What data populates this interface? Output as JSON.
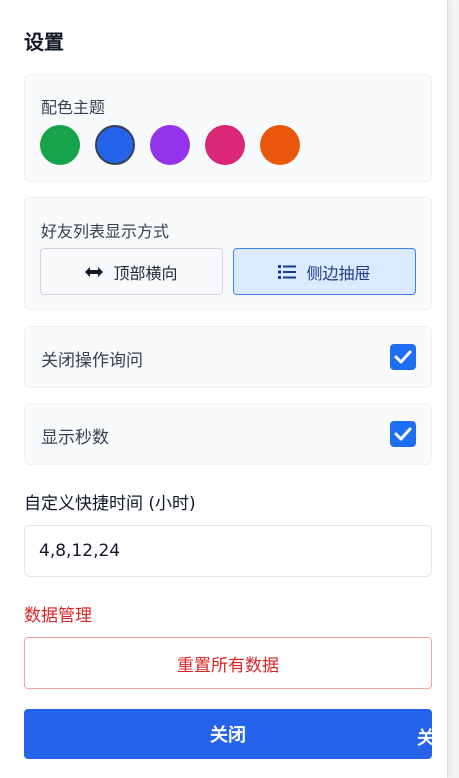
{
  "settings": {
    "title": "设置",
    "theme": {
      "label": "配色主题",
      "colors": [
        {
          "name": "green",
          "hex": "#16a34a"
        },
        {
          "name": "blue",
          "hex": "#2563eb",
          "selected": true
        },
        {
          "name": "purple",
          "hex": "#9333ea"
        },
        {
          "name": "pink",
          "hex": "#db2777"
        },
        {
          "name": "orange",
          "hex": "#ea580c"
        }
      ]
    },
    "friends_display": {
      "label": "好友列表显示方式",
      "options": [
        {
          "label": "顶部横向",
          "icon": "horizontal-arrows-icon",
          "active": false
        },
        {
          "label": "侧边抽屉",
          "icon": "list-icon",
          "active": true
        }
      ]
    },
    "confirm_close": {
      "label": "关闭操作询问",
      "checked": true
    },
    "show_seconds": {
      "label": "显示秒数",
      "checked": true
    },
    "shortcut_time": {
      "label": "自定义快捷时间 (小时)",
      "value": "4,8,12,24"
    },
    "data_management": {
      "label": "数据管理",
      "reset_label": "重置所有数据"
    },
    "close_label": "关闭"
  },
  "background": {
    "partial_text": "关"
  }
}
